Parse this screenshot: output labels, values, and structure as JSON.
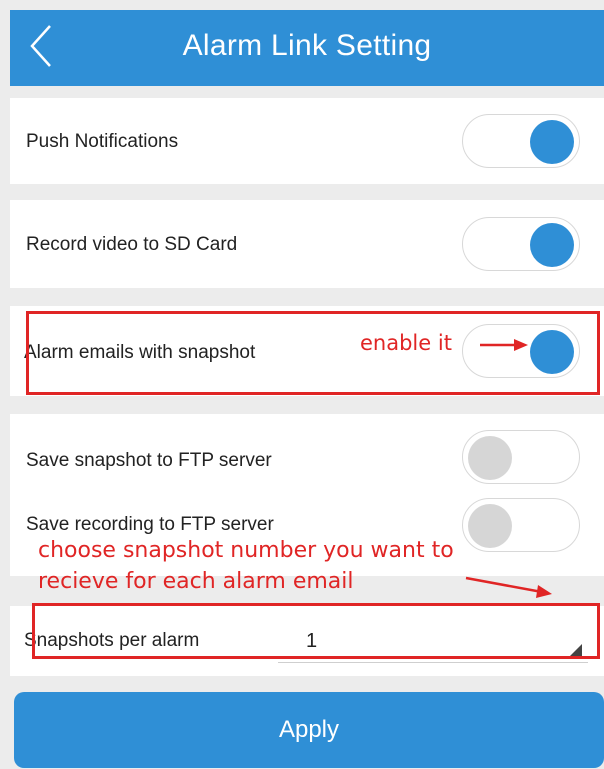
{
  "header": {
    "title": "Alarm Link Setting",
    "back_icon": "chevron-left-icon"
  },
  "settings": [
    {
      "label": "Push Notifications",
      "enabled": true
    },
    {
      "label": "Record video to SD Card",
      "enabled": true
    },
    {
      "label": "Alarm emails with snapshot",
      "enabled": true
    },
    {
      "label": "Save snapshot to FTP server",
      "enabled": false
    },
    {
      "label": "Save recording to FTP server",
      "enabled": false
    }
  ],
  "snapshots": {
    "label": "Snapshots per alarm",
    "value": "1"
  },
  "annotations": {
    "enable": "enable it",
    "choose_line1": "choose snapshot number you want to",
    "choose_line2": "recieve for each alarm email"
  },
  "apply_label": "Apply",
  "colors": {
    "accent": "#2f8fd6",
    "annotation": "#e02525",
    "background": "#ececec",
    "toggle_off": "#d6d6d6"
  }
}
